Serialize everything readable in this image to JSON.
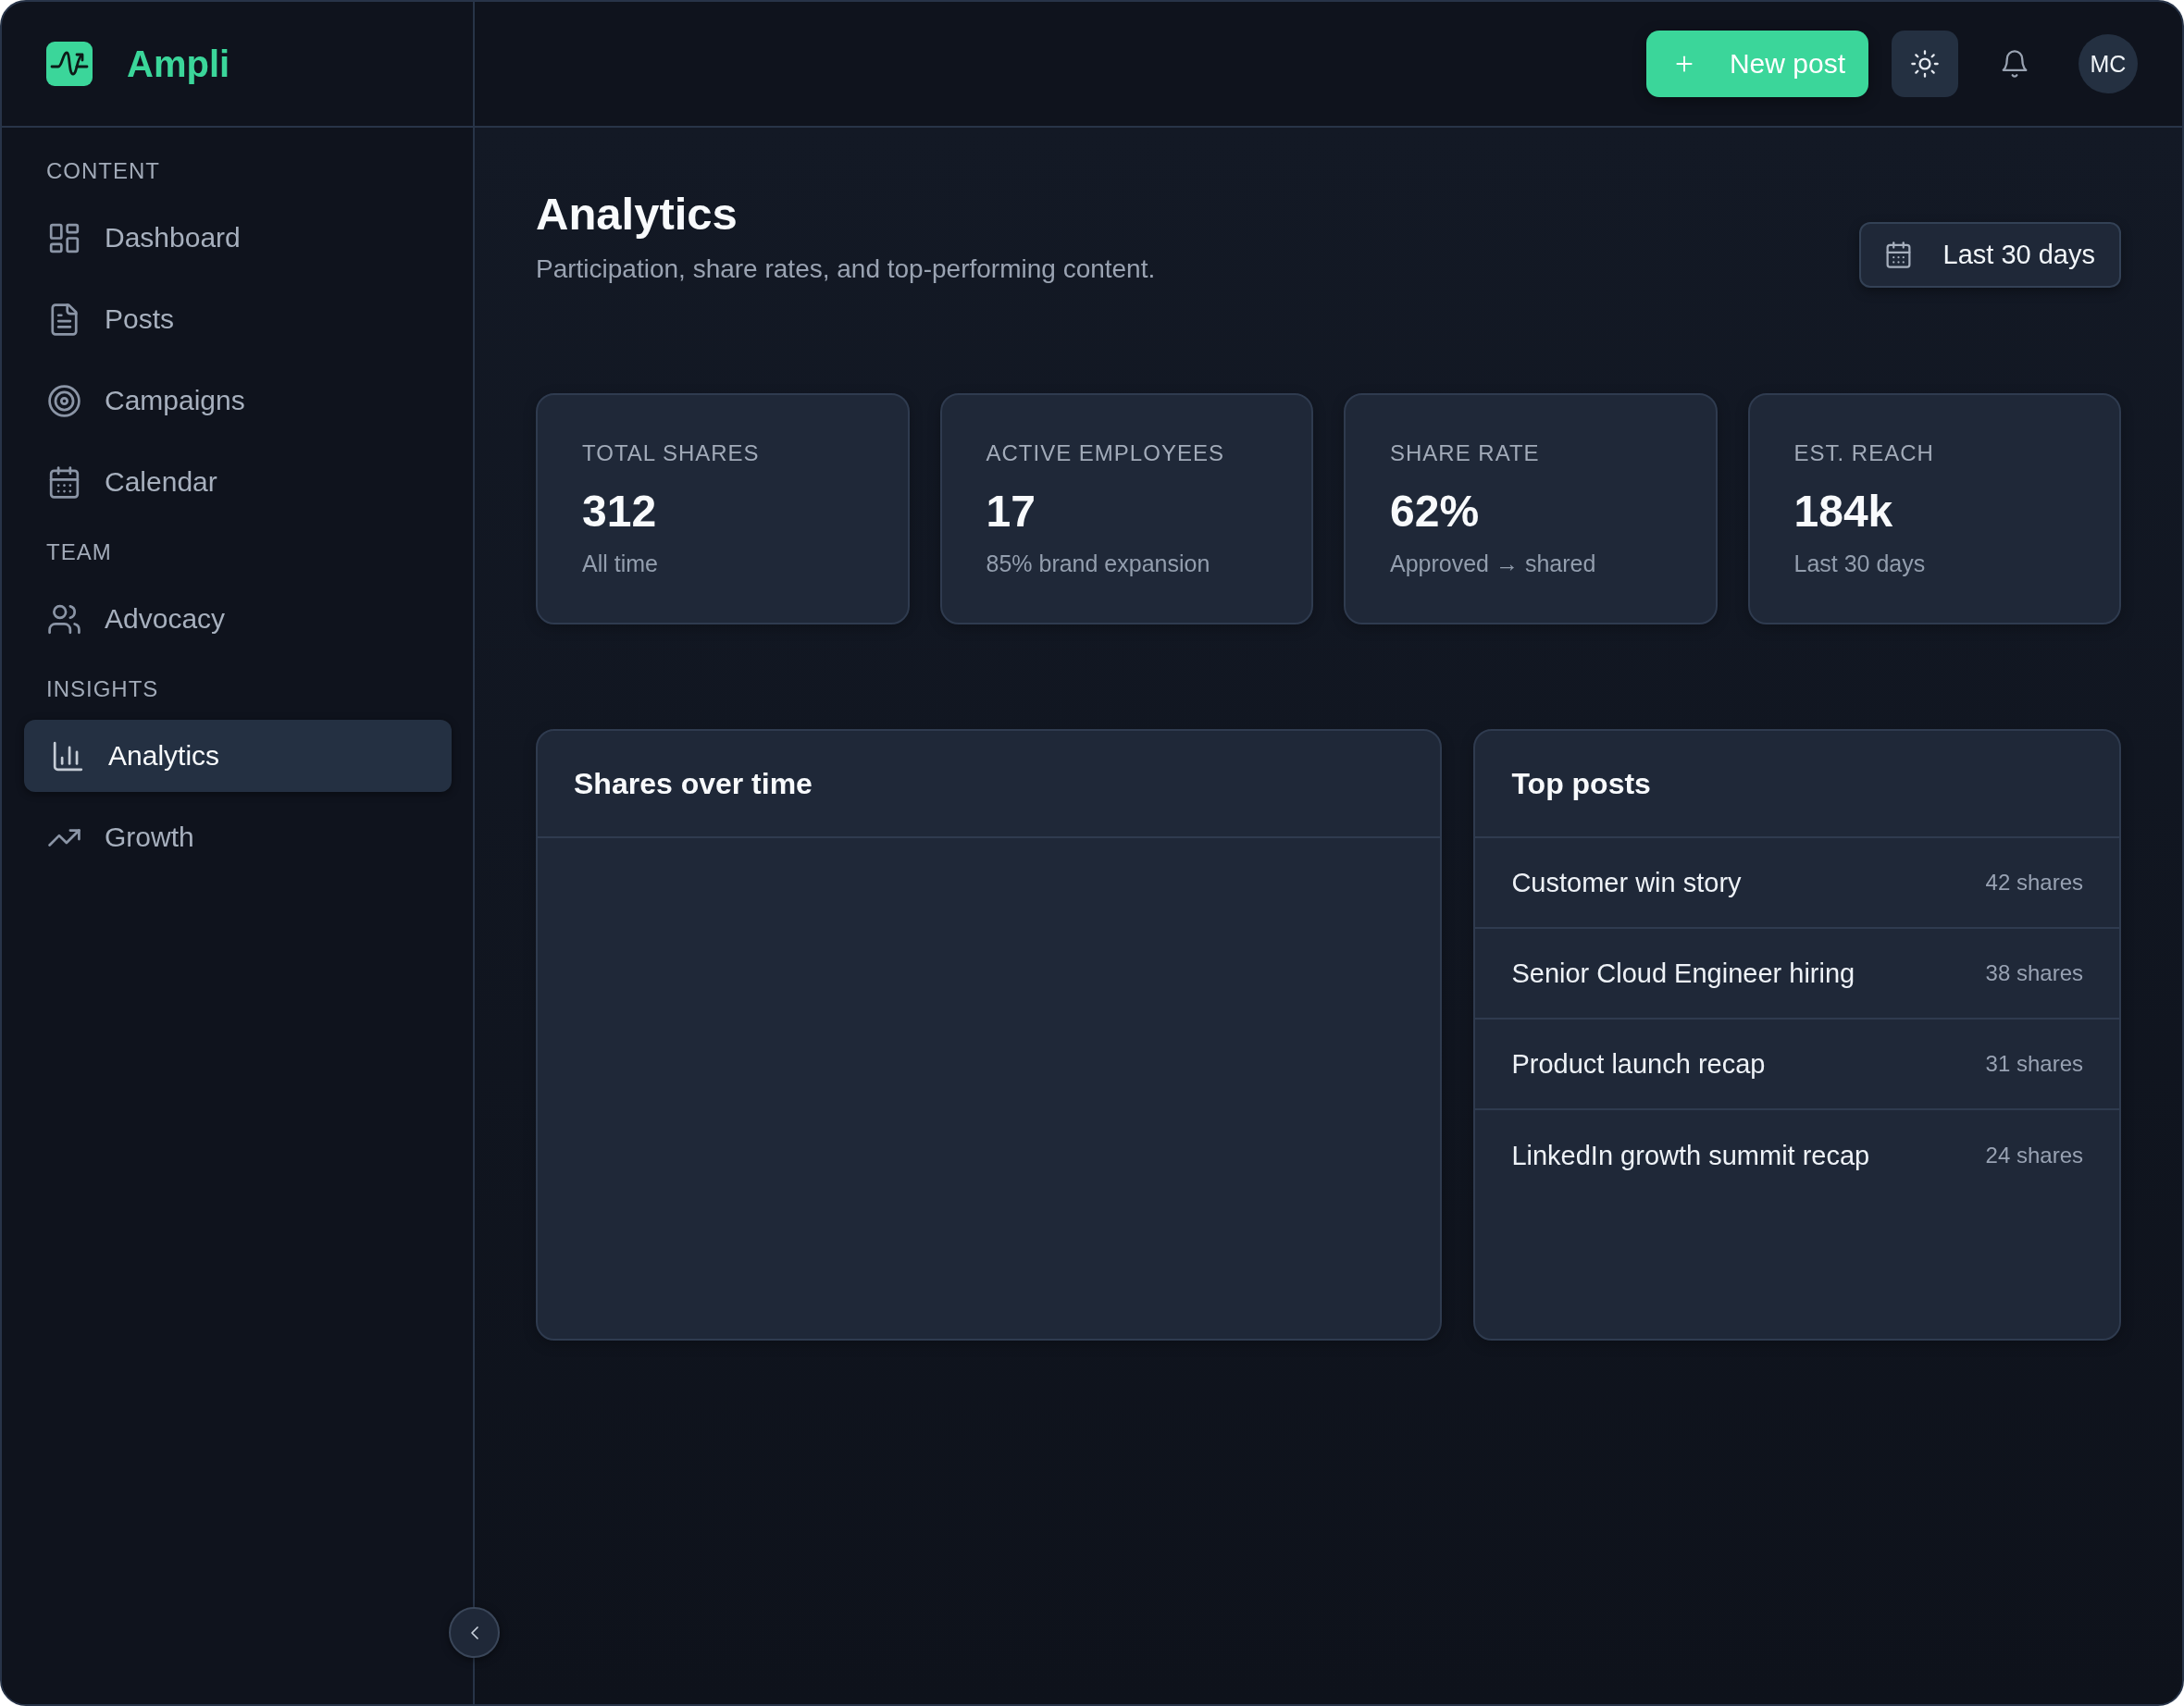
{
  "app": {
    "name": "Ampli"
  },
  "sidebar": {
    "sections": [
      {
        "title": "CONTENT",
        "items": [
          {
            "label": "Dashboard",
            "selected": false
          },
          {
            "label": "Posts",
            "selected": false
          },
          {
            "label": "Campaigns",
            "selected": false
          },
          {
            "label": "Calendar",
            "selected": false
          }
        ]
      },
      {
        "title": "TEAM",
        "items": [
          {
            "label": "Advocacy",
            "selected": false
          }
        ]
      },
      {
        "title": "INSIGHTS",
        "items": [
          {
            "label": "Analytics",
            "selected": true
          },
          {
            "label": "Growth",
            "selected": false
          }
        ]
      }
    ]
  },
  "topbar": {
    "new_post_button": "New post",
    "avatar": "MC"
  },
  "page": {
    "title": "Analytics",
    "subtitle": "Participation, share rates, and top-performing content.",
    "date_range": "Last 30 days"
  },
  "stats": [
    {
      "label": "TOTAL SHARES",
      "value": "312",
      "note": "All time"
    },
    {
      "label": "ACTIVE EMPLOYEES",
      "value": "17",
      "note": "85% brand expansion"
    },
    {
      "label": "SHARE RATE",
      "value": "62%",
      "note": "Approved → shared"
    },
    {
      "label": "EST. REACH",
      "value": "184k",
      "note": "Last 30 days"
    }
  ],
  "shares_chart": {
    "title": "Shares over time"
  },
  "top_posts": {
    "title": "Top posts",
    "rows": [
      {
        "title": "Customer win story",
        "shares": "42 shares"
      },
      {
        "title": "Senior Cloud Engineer hiring",
        "shares": "38 shares"
      },
      {
        "title": "Product launch recap",
        "shares": "31 shares"
      },
      {
        "title": "LinkedIn growth summit recap",
        "shares": "24 shares"
      }
    ]
  }
}
